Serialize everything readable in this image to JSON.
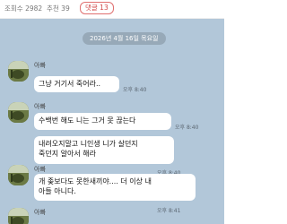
{
  "stats": {
    "views": "조회수 2982",
    "recommend": "추천 39",
    "comments": "댓글 13"
  },
  "chat": {
    "date": "2026년 4월 16일 목요일",
    "groups": [
      {
        "sender": "아빠",
        "messages": [
          {
            "text": "그냥 거기서 죽어라..",
            "time": "오후 8:40"
          }
        ]
      },
      {
        "sender": "아빠",
        "messages": [
          {
            "text": "수백번 해도 니는 그거 못 끊는다",
            "time": "오후 8:40"
          },
          {
            "lines": [
              "내려오지말고 니인생 니가 살던지",
              "죽던지 알아서 해라"
            ],
            "time": "오후 8:40"
          }
        ]
      },
      {
        "sender": "아빠",
        "messages": [
          {
            "lines": [
              "개 좆보다도 못한새끼야.... 더 이상 내",
              "아들 아니다."
            ],
            "time": "오후 8:41"
          }
        ]
      },
      {
        "sender": "아빠",
        "messages": []
      }
    ]
  },
  "colors": {
    "chat_background": "#b2c7d9",
    "bubble": "#ffffff",
    "comment_badge": "#d04848"
  }
}
